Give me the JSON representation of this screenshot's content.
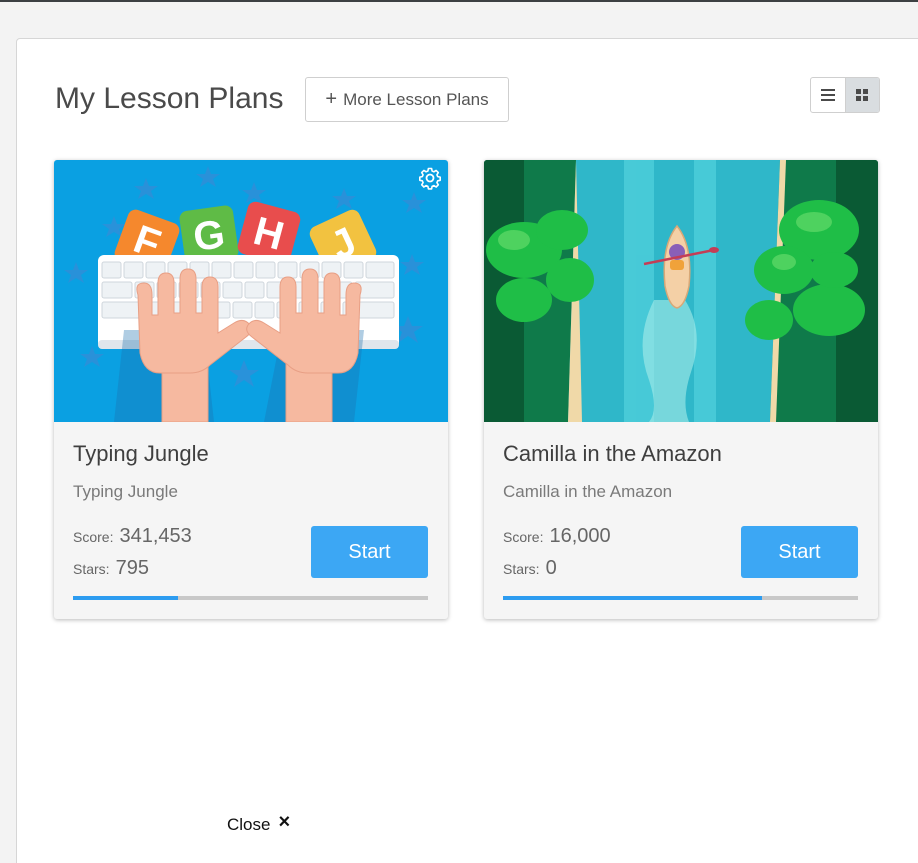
{
  "header": {
    "title": "My Lesson Plans",
    "more_button_label": "More Lesson Plans",
    "plus_icon": "+"
  },
  "view_toggle": {
    "list_icon": "list-icon",
    "grid_icon": "grid-icon",
    "active": "grid"
  },
  "cards": [
    {
      "title": "Typing Jungle",
      "subtitle": "Typing Jungle",
      "score_label": "Score:",
      "score": "341,453",
      "stars_label": "Stars:",
      "stars": "795",
      "start_label": "Start",
      "progress": 0.295,
      "letters": [
        "F",
        "G",
        "H",
        "J"
      ],
      "has_settings": true
    },
    {
      "title": "Camilla in the Amazon",
      "subtitle": "Camilla in the Amazon",
      "score_label": "Score:",
      "score": "16,000",
      "stars_label": "Stars:",
      "stars": "0",
      "start_label": "Start",
      "progress": 0.73,
      "has_settings": false
    }
  ],
  "footer": {
    "close_label": "Close",
    "close_icon": "×"
  },
  "colors": {
    "accent": "#3ca7f4",
    "progress_fill": "#2d9cf0",
    "progress_track": "#c8c8c8",
    "card_bg": "#f5f5f5"
  }
}
